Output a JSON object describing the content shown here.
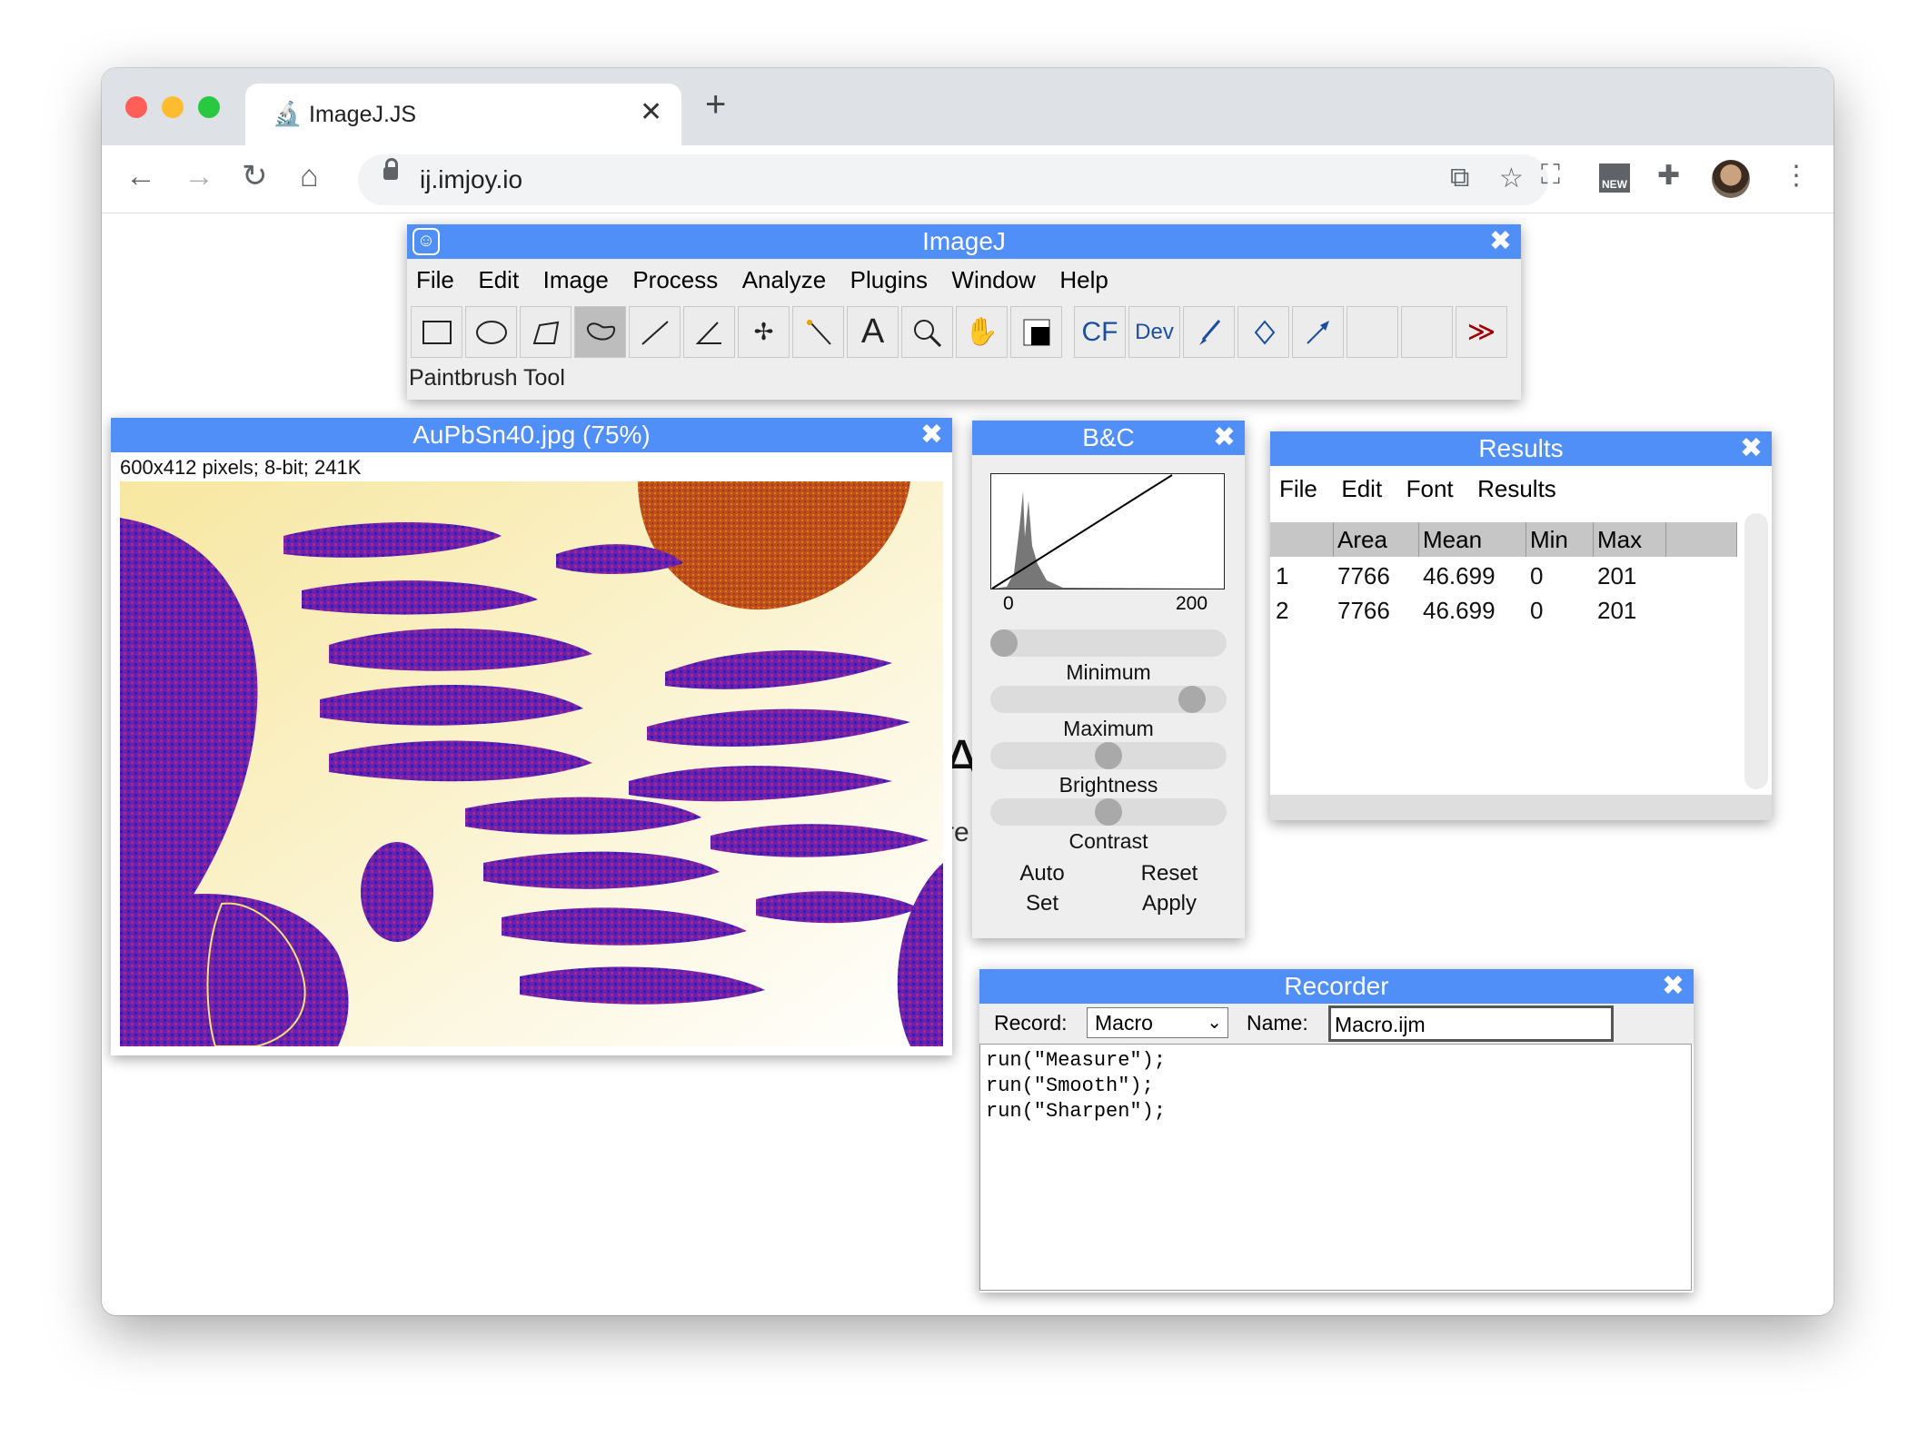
{
  "browser": {
    "tab_title": "ImageJ.JS",
    "tab_favicon": "microscope-icon",
    "url": "ij.imjoy.io",
    "ext_badge": "NEW"
  },
  "imagej": {
    "title": "ImageJ",
    "menu": [
      "File",
      "Edit",
      "Image",
      "Process",
      "Analyze",
      "Plugins",
      "Window",
      "Help"
    ],
    "tools": [
      "rectangle-icon",
      "oval-icon",
      "polygon-icon",
      "freehand-icon",
      "line-icon",
      "angle-icon",
      "multipoint-icon",
      "wand-icon",
      "text-icon",
      "magnifier-icon",
      "hand-icon",
      "color-picker-icon",
      "cf-icon",
      "dev-icon",
      "paintbrush-icon",
      "flood-fill-icon",
      "arrow-icon",
      "empty-slot",
      "empty-slot",
      "more-tools-icon"
    ],
    "tool_text": {
      "cf": "CF",
      "dev": "Dev",
      "more": "≫",
      "text": "A"
    },
    "status": "Paintbrush Tool"
  },
  "image_window": {
    "title": "AuPbSn40.jpg (75%)",
    "info": "600x412 pixels; 8-bit; 241K"
  },
  "bc": {
    "title": "B&C",
    "hist_min": "0",
    "hist_max": "200",
    "sliders": [
      {
        "label": "Minimum",
        "value": 0.0
      },
      {
        "label": "Maximum",
        "value": 0.9
      },
      {
        "label": "Brightness",
        "value": 0.5
      },
      {
        "label": "Contrast",
        "value": 0.5
      }
    ],
    "buttons": [
      "Auto",
      "Reset",
      "Set",
      "Apply"
    ]
  },
  "results": {
    "title": "Results",
    "menu": [
      "File",
      "Edit",
      "Font",
      "Results"
    ],
    "columns": [
      "",
      "Area",
      "Mean",
      "Min",
      "Max"
    ],
    "rows": [
      [
        "1",
        "7766",
        "46.699",
        "0",
        "201"
      ],
      [
        "2",
        "7766",
        "46.699",
        "0",
        "201"
      ]
    ]
  },
  "recorder": {
    "title": "Recorder",
    "record_label": "Record:",
    "record_value": "Macro",
    "name_label": "Name:",
    "name_value": "Macro.ijm",
    "code": [
      "run(\"Measure\");",
      "run(\"Smooth\");",
      "run(\"Sharpen\");"
    ]
  },
  "background_text": {
    "a": "A",
    "re": "re"
  }
}
